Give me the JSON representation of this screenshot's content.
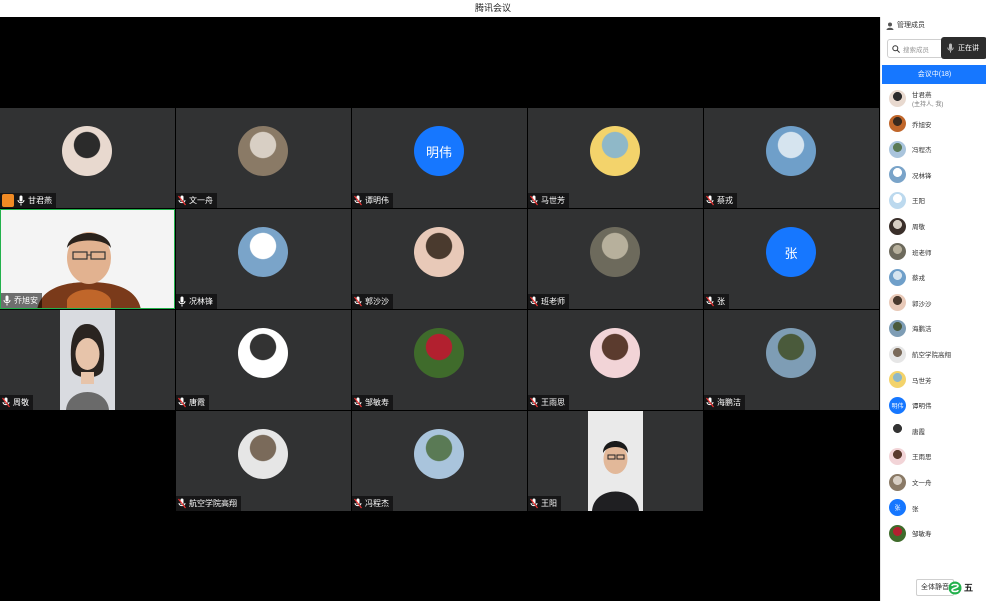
{
  "window": {
    "title": "腾讯会议"
  },
  "grid": {
    "tiles": [
      {
        "name": "甘君燕",
        "kind": "photo",
        "host": true,
        "colors": [
          "#e8d9cf",
          "#2b2b2b"
        ]
      },
      {
        "name": "文一舟",
        "kind": "photo",
        "colors": [
          "#8a7a66",
          "#d8cfc4"
        ]
      },
      {
        "name": "谭明伟",
        "kind": "text",
        "initials": "明伟"
      },
      {
        "name": "马世芳",
        "kind": "photo",
        "colors": [
          "#f3d36b",
          "#8fb8c8"
        ]
      },
      {
        "name": "蔡戎",
        "kind": "photo",
        "colors": [
          "#6f9fc9",
          "#d6e4ef"
        ]
      },
      {
        "name": "乔旭安",
        "kind": "video",
        "active": true
      },
      {
        "name": "况林锋",
        "kind": "photo",
        "colors": [
          "#7aa4c9",
          "#ffffff"
        ]
      },
      {
        "name": "郭沙沙",
        "kind": "photo",
        "colors": [
          "#e8c9b8",
          "#4a3a2e"
        ]
      },
      {
        "name": "班老师",
        "kind": "photo",
        "colors": [
          "#6d6a5c",
          "#b7b09c"
        ]
      },
      {
        "name": "张",
        "kind": "text",
        "initials": "张"
      },
      {
        "name": "周敬",
        "kind": "video-portrait"
      },
      {
        "name": "唐霞",
        "kind": "photo",
        "colors": [
          "#ffffff",
          "#333333"
        ]
      },
      {
        "name": "邹敏寿",
        "kind": "photo",
        "colors": [
          "#3f6b2b",
          "#b2202f"
        ]
      },
      {
        "name": "王雨思",
        "kind": "photo",
        "colors": [
          "#f2d4d7",
          "#5b3b2e"
        ]
      },
      {
        "name": "海鹏洁",
        "kind": "photo",
        "colors": [
          "#7e9db5",
          "#4a5a3b"
        ]
      },
      {
        "name": "航空学院高翔",
        "kind": "photo",
        "colors": [
          "#e6e6e6",
          "#7a6a5a"
        ]
      },
      {
        "name": "冯程杰",
        "kind": "photo",
        "colors": [
          "#a9c4dc",
          "#5a7a55"
        ]
      },
      {
        "name": "王阳",
        "kind": "video-portrait2"
      }
    ]
  },
  "sidebar": {
    "header": "管理成员",
    "search_placeholder": "搜索成员",
    "speaking_label": "正在讲",
    "tab_label": "会议中(18)",
    "members": [
      {
        "name": "甘君燕",
        "sub": "(主持人, 我)",
        "colors": [
          "#e8d9cf",
          "#2b2b2b"
        ]
      },
      {
        "name": "乔旭安",
        "colors": [
          "#c0662a",
          "#3a2a1e"
        ]
      },
      {
        "name": "冯程杰",
        "colors": [
          "#a9c4dc",
          "#5a7a55"
        ]
      },
      {
        "name": "况林锋",
        "colors": [
          "#7aa4c9",
          "#ffffff"
        ]
      },
      {
        "name": "王阳",
        "colors": [
          "#bcd9ee",
          "#ffffff"
        ]
      },
      {
        "name": "周敬",
        "colors": [
          "#3a2f2a",
          "#d8cfc4"
        ]
      },
      {
        "name": "班老师",
        "colors": [
          "#6d6a5c",
          "#b7b09c"
        ]
      },
      {
        "name": "蔡戎",
        "colors": [
          "#6f9fc9",
          "#d6e4ef"
        ]
      },
      {
        "name": "郭沙沙",
        "colors": [
          "#e8c9b8",
          "#4a3a2e"
        ]
      },
      {
        "name": "海鹏洁",
        "colors": [
          "#7e9db5",
          "#4a5a3b"
        ]
      },
      {
        "name": "航空学院高翔",
        "colors": [
          "#e6e6e6",
          "#7a6a5a"
        ]
      },
      {
        "name": "马世芳",
        "colors": [
          "#f3d36b",
          "#8fb8c8"
        ]
      },
      {
        "name": "谭明伟",
        "initials": "明伟"
      },
      {
        "name": "唐霞",
        "colors": [
          "#ffffff",
          "#333333"
        ]
      },
      {
        "name": "王雨思",
        "colors": [
          "#f2d4d7",
          "#5b3b2e"
        ]
      },
      {
        "name": "文一舟",
        "colors": [
          "#8a7a66",
          "#d8cfc4"
        ]
      },
      {
        "name": "张",
        "initials": "张"
      },
      {
        "name": "邹敏寿",
        "colors": [
          "#3f6b2b",
          "#b2202f"
        ]
      }
    ],
    "mute_all_label": "全体静音",
    "logo_text": "五"
  },
  "colors": {
    "accent": "#1677ff",
    "stage": "#000000",
    "tile": "#313233",
    "active_border": "#22b14c",
    "host_badge": "#f08a24"
  }
}
